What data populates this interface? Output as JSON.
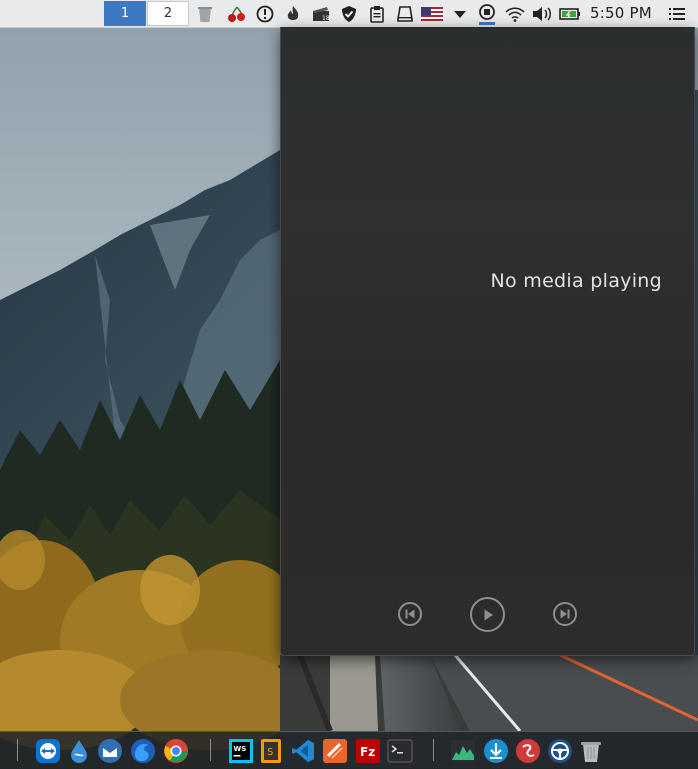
{
  "panel": {
    "desktops": [
      "1",
      "2"
    ],
    "clock": "5:50 PM",
    "tray_icons": [
      "trash-icon",
      "cherry-icon",
      "notification-icon",
      "flame-icon",
      "clapper-icon",
      "shield-check-icon",
      "clipboard-icon",
      "drive-icon",
      "us-flag-icon",
      "triangle-down-icon",
      "media-player-icon",
      "wifi-icon",
      "volume-icon",
      "battery-icon",
      "menu-icon"
    ],
    "accent": "#3c79c2"
  },
  "media": {
    "status": "No media playing",
    "controls": [
      "previous-icon",
      "play-icon",
      "next-icon"
    ]
  },
  "dock": {
    "apps_group1": [
      "teamviewer-icon",
      "water-drop-icon",
      "mail-bird-icon",
      "firefox-icon",
      "chrome-icon"
    ],
    "apps_group2": [
      "webstorm-icon",
      "sublime-icon",
      "vscode-icon",
      "postman-icon",
      "filezilla-icon",
      "terminal-icon"
    ],
    "apps_group3": [
      "system-monitor-icon",
      "download-icon",
      "scroll-icon",
      "steering-icon",
      "dock-trash-icon"
    ]
  }
}
